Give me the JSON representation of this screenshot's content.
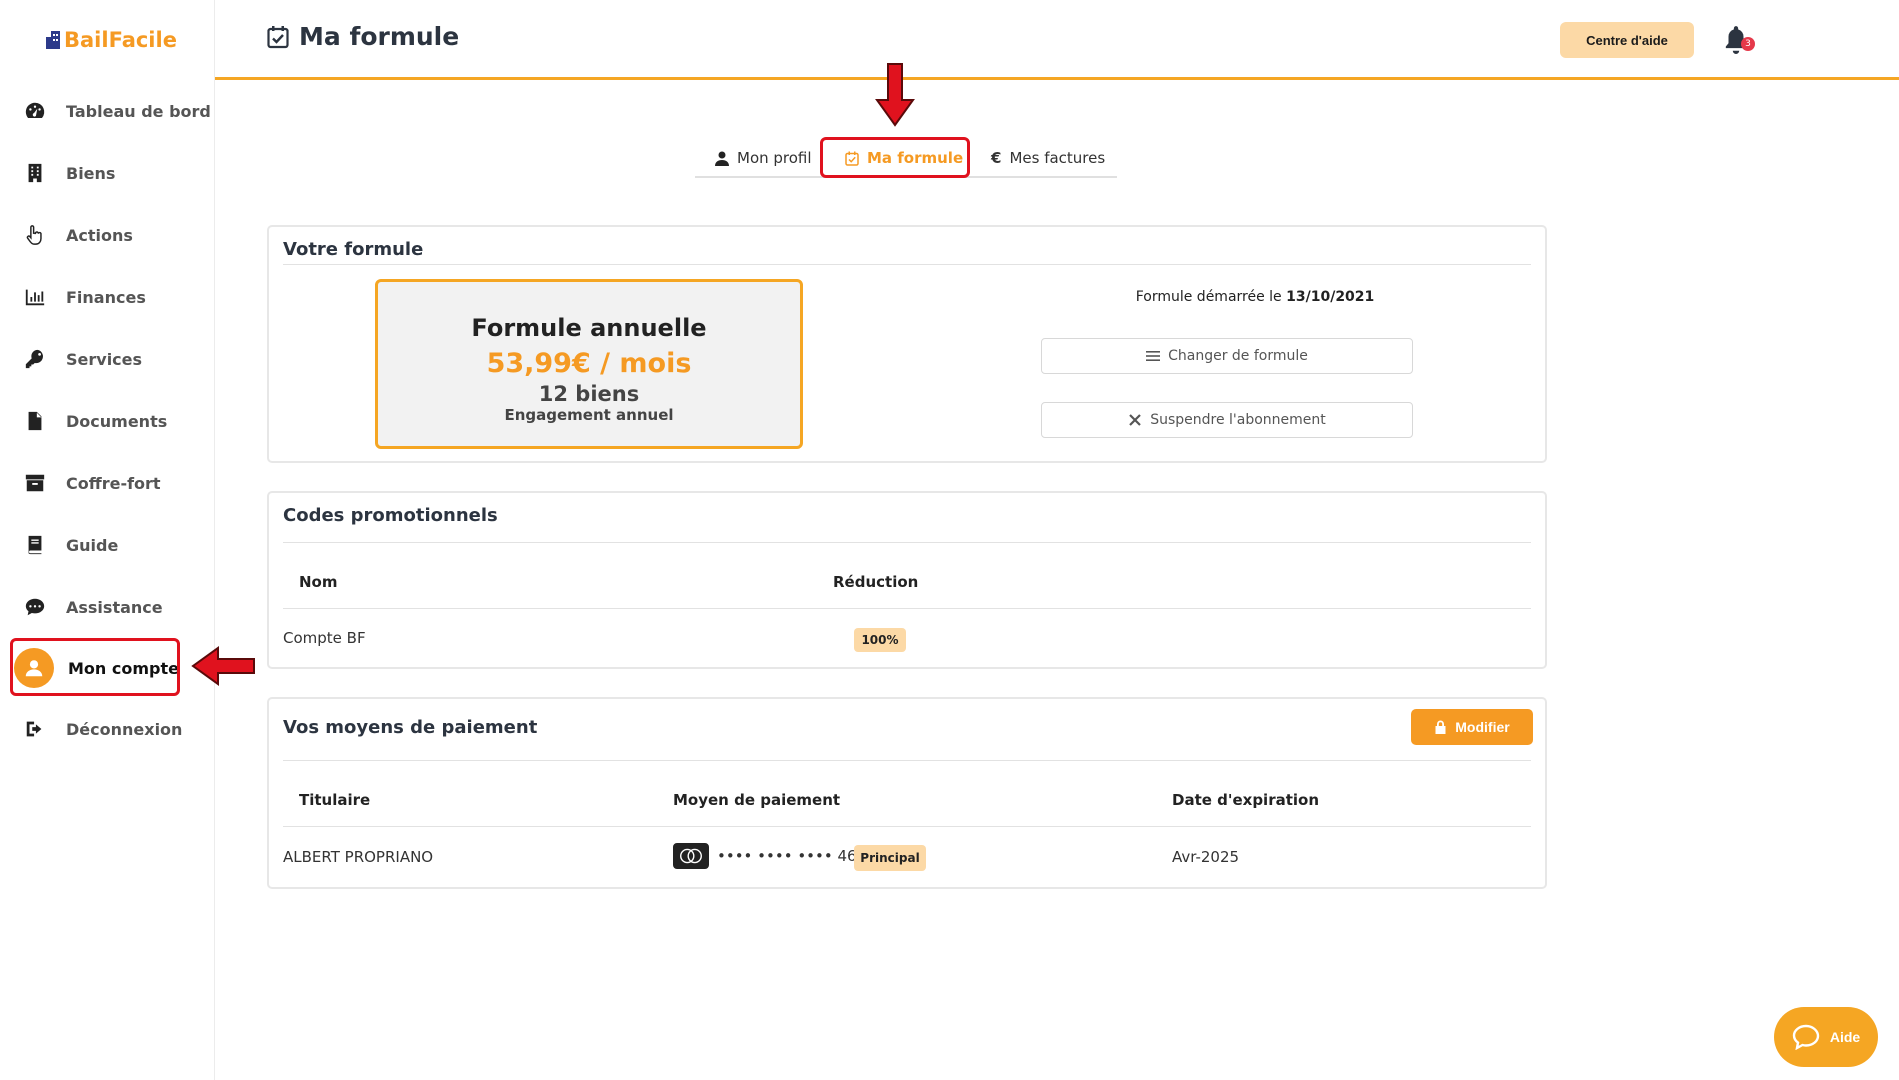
{
  "brand": {
    "name": "BailFacile"
  },
  "sidebar": {
    "items": [
      {
        "label": "Tableau de bord",
        "icon": "dashboard-icon"
      },
      {
        "label": "Biens",
        "icon": "building-icon"
      },
      {
        "label": "Actions",
        "icon": "pointer-hand-icon"
      },
      {
        "label": "Finances",
        "icon": "bar-chart-icon"
      },
      {
        "label": "Services",
        "icon": "key-icon"
      },
      {
        "label": "Documents",
        "icon": "document-icon"
      },
      {
        "label": "Coffre-fort",
        "icon": "archive-box-icon"
      },
      {
        "label": "Guide",
        "icon": "book-icon"
      },
      {
        "label": "Assistance",
        "icon": "chat-bubble-icon"
      },
      {
        "label": "Mon compte",
        "icon": "user-avatar-icon",
        "active": true
      },
      {
        "label": "Déconnexion",
        "icon": "sign-out-icon"
      }
    ]
  },
  "header": {
    "title": "Ma formule",
    "help_label": "Centre d'aide",
    "notification_count": "3"
  },
  "tabs": [
    {
      "label": "Mon profil",
      "icon": "user-icon"
    },
    {
      "label": "Ma formule",
      "icon": "calendar-check-icon",
      "active": true
    },
    {
      "label": "Mes factures",
      "icon": "euro-icon"
    }
  ],
  "formula": {
    "section_title": "Votre formule",
    "plan_name": "Formule annuelle",
    "price": "53,99€ / mois",
    "properties": "12 biens",
    "commitment": "Engagement annuel",
    "start_prefix": "Formule démarrée le",
    "start_date": "13/10/2021",
    "change_label": "Changer de formule",
    "suspend_label": "Suspendre l'abonnement"
  },
  "promo": {
    "section_title": "Codes promotionnels",
    "headers": [
      "Nom",
      "Réduction"
    ],
    "rows": [
      {
        "name": "Compte BF",
        "discount": "100%"
      }
    ]
  },
  "payment": {
    "section_title": "Vos moyens de paiement",
    "modify_label": "Modifier",
    "headers": [
      "Titulaire",
      "Moyen de paiement",
      "Date d'expiration"
    ],
    "rows": [
      {
        "holder": "ALBERT PROPRIANO",
        "card_mask": "•••• •••• •••• 4659",
        "tag": "Principal",
        "expiry": "Avr-2025"
      }
    ]
  },
  "fab": {
    "label": "Aide"
  },
  "colors": {
    "accent": "#f59a23",
    "accent_light": "#fcd9a6",
    "annotation": "#e0121e",
    "title": "#2c3440"
  }
}
